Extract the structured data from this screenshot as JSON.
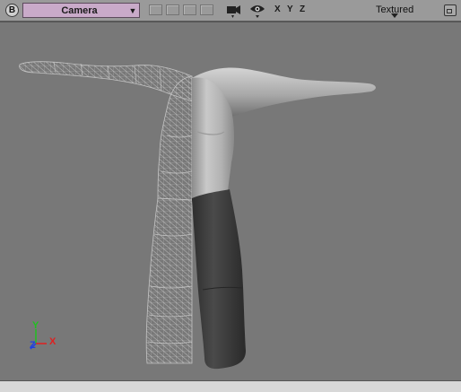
{
  "toolbar": {
    "viewport_label": "B",
    "camera_select": {
      "value": "Camera",
      "arrow": "▼"
    },
    "axis_buttons": [
      "X",
      "Y",
      "Z"
    ],
    "display_mode": {
      "value": "Textured"
    }
  },
  "axis_gizmo": {
    "y_label": "Y",
    "z_label": "Z",
    "x_label": "X",
    "colors": {
      "x": "#e02020",
      "y": "#20c020",
      "z": "#2040e0"
    }
  },
  "model": {
    "left_side": "wireframe-mesh",
    "right_side": "shaded-surface",
    "colors": {
      "wire": "#b8b8b8",
      "skin": "#a8a8a8",
      "pants": "#3c3c3c"
    }
  }
}
